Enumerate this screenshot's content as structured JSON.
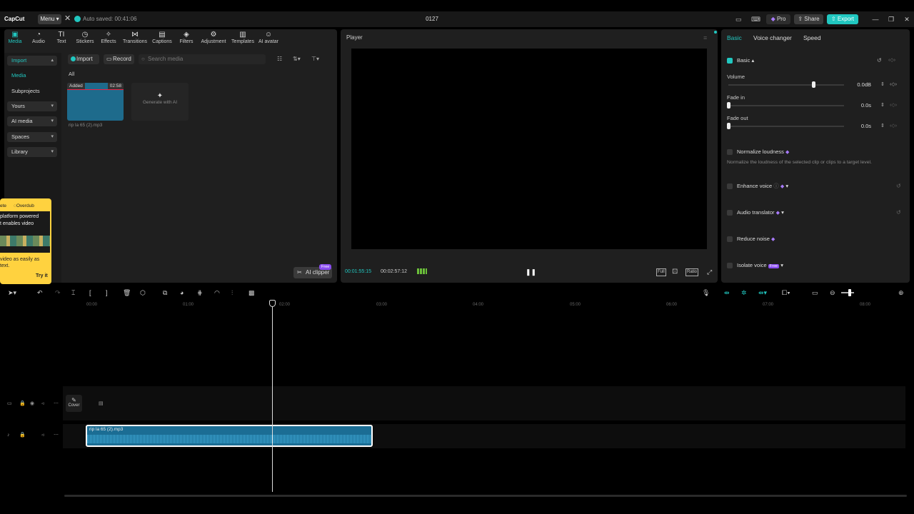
{
  "titlebar": {
    "logo": "CapCut",
    "menu_label": "Menu",
    "autosave": "Auto saved: 00:41:06",
    "project_name": "0127",
    "pro_label": "Pro",
    "share_label": "Share",
    "export_label": "Export"
  },
  "tool_tabs": [
    {
      "label": "Media",
      "icon": "media-icon"
    },
    {
      "label": "Audio",
      "icon": "audio-icon"
    },
    {
      "label": "Text",
      "icon": "text-icon"
    },
    {
      "label": "Stickers",
      "icon": "stickers-icon"
    },
    {
      "label": "Effects",
      "icon": "effects-icon"
    },
    {
      "label": "Transitions",
      "icon": "transitions-icon"
    },
    {
      "label": "Captions",
      "icon": "captions-icon"
    },
    {
      "label": "Filters",
      "icon": "filters-icon"
    },
    {
      "label": "Adjustment",
      "icon": "adjustment-icon"
    },
    {
      "label": "Templates",
      "icon": "templates-icon"
    },
    {
      "label": "AI avatar",
      "icon": "ai-avatar-icon"
    }
  ],
  "sidebar": {
    "import": "Import",
    "media": "Media",
    "subprojects": "Subprojects",
    "yours": "Yours",
    "ai_media": "AI media",
    "spaces": "Spaces",
    "library": "Library"
  },
  "media": {
    "import_btn": "Import",
    "record_btn": "Record",
    "search_placeholder": "Search media",
    "filter_all": "All",
    "clip_badge": "Added",
    "clip_duration": "02:58",
    "clip_name": "rip la 65 (2).mp3",
    "generate_ai": "Generate with AI",
    "ai_clipper": "AI clipper",
    "free_badge": "Free"
  },
  "promo": {
    "tab1": "ete",
    "tab2": "Overdub",
    "line1": "platform powered",
    "line2": "t enables video",
    "line3": "video as easily as",
    "line4": "text.",
    "try_it": "Try it"
  },
  "player": {
    "title": "Player",
    "time_current": "00:01:55:15",
    "time_total": "00:02:57:12",
    "full_label": "Full",
    "ratio_label": "Ratio"
  },
  "inspector": {
    "tabs": [
      "Basic",
      "Voice changer",
      "Speed"
    ],
    "section": "Basic",
    "volume_label": "Volume",
    "volume_value": "0.0dB",
    "fade_in_label": "Fade in",
    "fade_in_value": "0.0s",
    "fade_out_label": "Fade out",
    "fade_out_value": "0.0s",
    "normalize": "Normalize loudness",
    "normalize_desc": "Normalize the loudness of the selected clip or clips to a target level.",
    "enhance": "Enhance voice",
    "translator": "Audio translator",
    "reduce_noise": "Reduce noise",
    "isolate": "Isolate voice",
    "isolate_badge": "Free"
  },
  "timeline": {
    "ticks": [
      "00:00",
      "01:00",
      "02:00",
      "03:00",
      "04:00",
      "05:00",
      "06:00",
      "07:00",
      "08:00"
    ],
    "cover_label": "Cover",
    "audio_clip_name": "rip la 65 (2).mp3",
    "playhead_fraction": 0.65
  },
  "colors": {
    "accent": "#21c7c0",
    "panel": "#1f1f1f",
    "audio_clip": "#1b6d94",
    "promo": "#ffd23f"
  }
}
